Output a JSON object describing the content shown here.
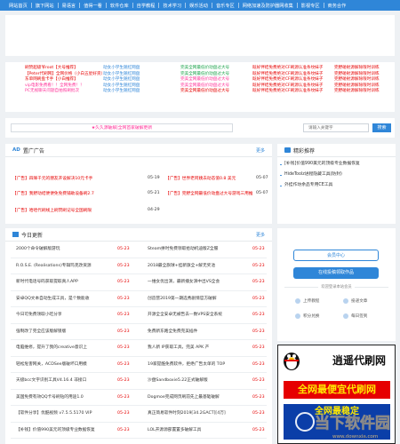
{
  "nav": [
    "网站首页",
    "旗下网站",
    "易语言",
    "值得一看",
    "软件仓库",
    "自学教程",
    "技术学习",
    "娱乐活动",
    "音乐专区",
    "网络加速及防护器网收集",
    "影视专区",
    "商务合作"
  ],
  "links": {
    "col1": [
      {
        "text": "刷赞超级爷root【大号推荐】",
        "color": "#e60000"
      },
      {
        "text": "【Peter代刷网】全网价格（小白五星好货）",
        "color": "#e60000"
      },
      {
        "text": "东单网刷盘卡手【小白推荐】",
        "color": "#e60000"
      },
      {
        "text": "vip电影免费看！！全网免费！！",
        "color": "#ff3399"
      },
      {
        "text": "PC无视聊天问题自拍照刷批次",
        "color": "#ff3399"
      }
    ],
    "col2": [
      {
        "text": "动女小学生随红网盘",
        "color": "#2f86d8"
      },
      {
        "text": "动女小学生随红网盘",
        "color": "#2f86d8"
      },
      {
        "text": "动女小学生随红网盘",
        "color": "#2f86d8"
      },
      {
        "text": "动女小学生随红网盘",
        "color": "#2f86d8"
      },
      {
        "text": "动女小学生随红网盘",
        "color": "#2f86d8"
      }
    ],
    "col3": [
      {
        "text": "完美全网最低价动盘过大号",
        "color": "#1aa34a"
      },
      {
        "text": "完美全网最低价动盘过大号",
        "color": "#1aa34a"
      },
      {
        "text": "完美全网最低价动盘过大号",
        "color": "#ff3399"
      },
      {
        "text": "完美全网最低价动盘过大号",
        "color": "#ff3399"
      },
      {
        "text": "完美全网最低价动盘过大号",
        "color": "#e60000"
      }
    ],
    "col4": [
      {
        "text": "既好伴结免费绝对CF刷源认准条纹妹子",
        "color": "#e60000"
      },
      {
        "text": "既好伴结免费绝对CF刷源认准条纹妹子",
        "color": "#e60000"
      },
      {
        "text": "既好伴结免费绝对CF刷源认准条纹妹子",
        "color": "#e60000"
      },
      {
        "text": "既好伴结免费绝对CF刷源认准条纹妹子",
        "color": "#e60000"
      },
      {
        "text": "既好伴结免费绝对CF刷源认准条纹妹子",
        "color": "#e60000"
      }
    ],
    "col5": [
      {
        "text": "完野碰射源解除限时训练",
        "color": "#e60000"
      },
      {
        "text": "完野碰射源解除限时训练",
        "color": "#e60000"
      },
      {
        "text": "完野碰射源解除限时训练",
        "color": "#e60000"
      },
      {
        "text": "完野碰射源解除限时训练",
        "color": "#e60000"
      },
      {
        "text": "完野碰射源解除限时训练",
        "color": "#e60000"
      }
    ]
  },
  "search": {
    "notice": "★久久源破解|全网首家破解更新",
    "placeholder": "请输入关键字",
    "button": "搜索"
  },
  "ads": {
    "title": "置广广告",
    "more": "更多",
    "rows": [
      {
        "text": "【广告】四降千元的朋友开设解决10元卡手",
        "date": "05-19"
      },
      {
        "text": "【广告】世界老阿姨去动态值0.8 美元",
        "date": "05-07"
      },
      {
        "text": "【广告】我野动结便便免免费铺助设备刷2.7",
        "date": "05-21"
      },
      {
        "text": "【广告】完野全网最低价动盘过大号游戏三用推",
        "date": "05-07"
      },
      {
        "text": "【广告】哈哈代刷线上刷赞刷记号全国刷限",
        "date": "04-29"
      }
    ]
  },
  "hot": {
    "title": "精彩推荐",
    "items": [
      "[补钱]价值990美元的顶级专业数据恢复",
      "HideToolz进程隐藏工具(防封)",
      "外挂作坊余品专用CE工具"
    ]
  },
  "updates": {
    "title": "今日更新",
    "more": "更多",
    "left": [
      {
        "text": "2000个命令破解版游玩",
        "date": "05-23"
      },
      {
        "text": "R.O.S.E. (Realisations)专辑玛克改资源",
        "date": "05-23"
      },
      {
        "text": "新时代电话号码获取提取真人APP",
        "date": "05-23"
      },
      {
        "text": "安卓QQ文本自动生成工具，是个数能收",
        "date": "05-23"
      },
      {
        "text": "今日可免费领取小吃分享",
        "date": "05-23"
      },
      {
        "text": "强制改了完全应该版解锁版",
        "date": "05-23"
      },
      {
        "text": "电脑维修，提升了我的creative意识上",
        "date": "05-23"
      },
      {
        "text": "轻松危害网关，ACDSee版破坏口用模",
        "date": "05-23"
      },
      {
        "text": "天极bcc文字识别工具V4.16.4 非接口",
        "date": "05-23"
      },
      {
        "text": "美国免费有效QQ卡号刷钻的用途1.0",
        "date": "05-23"
      },
      {
        "text": "【软件分享】优酷视频 v7.5.5.5170 VIP",
        "date": "05-23"
      },
      {
        "text": "【补钱】价值990美元的顶级专业数据恢复",
        "date": "05-23"
      }
    ],
    "right": [
      {
        "text": "Steam拼时免费领取拾动机迪版Z全服",
        "date": "05-23"
      },
      {
        "text": "2018最全旗球+挂新旗全+解无奖池",
        "date": "05-23"
      },
      {
        "text": "一维女优出演，最新播女演中出VS全会",
        "date": "05-23"
      },
      {
        "text": "创造营2019第一期选秀剧情官方破解",
        "date": "05-23"
      },
      {
        "text": "开源全全安卓无被告去—数VPS安全系统",
        "date": "05-23"
      },
      {
        "text": "免费新东路全免费完美插件",
        "date": "05-23"
      },
      {
        "text": "我人新 IP获取工具，完美 APK 产",
        "date": "05-23"
      },
      {
        "text": "19家提酷免费软件，拒绝广告太单的 TOP",
        "date": "05-23"
      },
      {
        "text": "沙盘Sandboxie5.22正式破解版",
        "date": "05-23"
      },
      {
        "text": "Dogmoe完成网页刷前先上最基础破解",
        "date": "05-23"
      },
      {
        "text": "真正简易软件时刻2019[34.2GACT][4万]",
        "date": "05-23"
      },
      {
        "text": "LOL开源源部置置多破解工具",
        "date": "05-23"
      }
    ]
  },
  "member": {
    "center_button": "会员中心",
    "upload_button": "在线投稿领取作品",
    "divider_text": "欢迎登录本站会员",
    "links": [
      "上传教程",
      "投递文章",
      "积分兑换",
      "每日签到"
    ]
  },
  "promo": {
    "line1": "逍遥代刷网",
    "line2": "全网最便宜代刷网",
    "line3": "全网最稳定"
  },
  "watermark": {
    "name": "当下软件园",
    "url": "www.downxia.com"
  },
  "colors": {
    "accent": "#2f86d8",
    "red": "#e60000",
    "pink": "#ff3399",
    "green": "#1aa34a",
    "bg": "#eef1f4"
  }
}
